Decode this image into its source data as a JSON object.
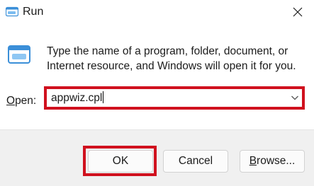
{
  "window": {
    "title": "Run",
    "icon": "run-app-icon",
    "close_icon": "close-icon"
  },
  "content": {
    "icon": "run-icon",
    "description": "Type the name of a program, folder, document, or Internet resource, and Windows will open it for you."
  },
  "open_field": {
    "label_accel": "O",
    "label_rest": "pen:",
    "value": "appwiz.cpl",
    "dropdown_icon": "chevron-down-icon"
  },
  "buttons": {
    "ok": "OK",
    "cancel": "Cancel",
    "browse_accel": "B",
    "browse_rest": "rowse..."
  },
  "colors": {
    "highlight": "#d0111e",
    "icon_blue": "#3b8fd8",
    "footer_bg": "#f0f0f0"
  }
}
